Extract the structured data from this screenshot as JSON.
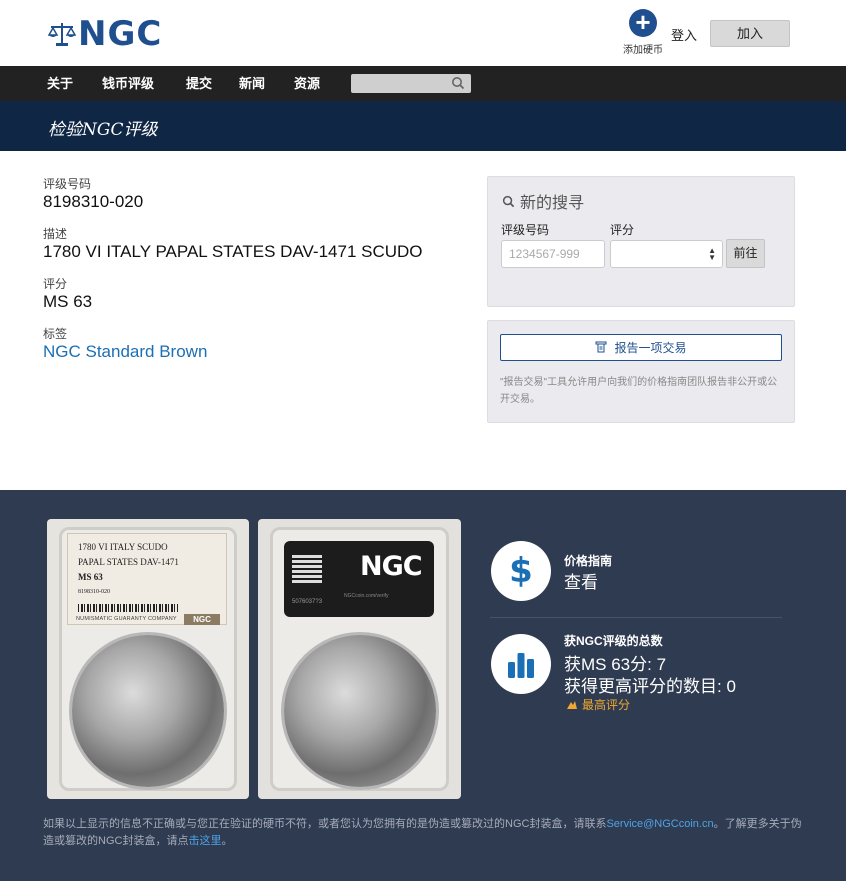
{
  "header": {
    "logo_text": "NGC",
    "add_coin_label": "添加硬币",
    "login_label": "登入",
    "join_label": "加入"
  },
  "nav": {
    "items": [
      "关于",
      "钱币评级",
      "提交",
      "新闻",
      "资源"
    ],
    "search_placeholder": ""
  },
  "banner": {
    "title": "检验NGC评级"
  },
  "details": {
    "cert_label": "评级号码",
    "cert_value": "8198310-020",
    "desc_label": "描述",
    "desc_value": "1780 VI ITALY PAPAL STATES DAV-1471 SCUDO",
    "grade_label": "评分",
    "grade_value": "MS 63",
    "holder_label": "标签",
    "holder_value": "NGC Standard Brown"
  },
  "search": {
    "title": "新的搜寻",
    "cert_label": "评级号码",
    "grade_label": "评分",
    "cert_placeholder": "1234567-999",
    "grade_value": "",
    "go_label": "前往"
  },
  "report": {
    "button_label": "报告一项交易",
    "note": "\"报告交易\"工具允许用户向我们的价格指南团队报告非公开或公开交易。"
  },
  "slab": {
    "line1": "1780 VI ITALY SCUDO",
    "line2": "PAPAL STATES DAV-1471",
    "grade": "MS 63",
    "cert": "8198310-020",
    "company": "NUMISMATIC GUARANTY COMPANY",
    "company_logo": "NGC",
    "back_logo": "NGC",
    "back_url": "NGCcoin.com/verify",
    "back_number": "5076037?3"
  },
  "price_guide": {
    "title": "价格指南",
    "value": "查看"
  },
  "census": {
    "title": "获NGC评级的总数",
    "at_grade": "获MS 63分: 7",
    "higher": "获得更高评分的数目: 0",
    "top_pop_label": "最高评分"
  },
  "disclaimer": {
    "text1": "如果以上显示的信息不正确或与您正在验证的硬币不符，或者您认为您拥有的是伪造或篡改过的NGC封装盒，请联系",
    "email": "Service@NGCcoin.cn",
    "text2": "。了解更多关于伪造或篡改的NGC封装盒，请点",
    "link": "击这里",
    "text3": "。"
  },
  "colors": {
    "brand_blue": "#1f4f8f",
    "nav_bg": "#222222",
    "banner_bg": "#0f2744",
    "dark_bg": "#2f3b50",
    "link_blue": "#1a6fb5",
    "top_pop": "#f0a830"
  }
}
